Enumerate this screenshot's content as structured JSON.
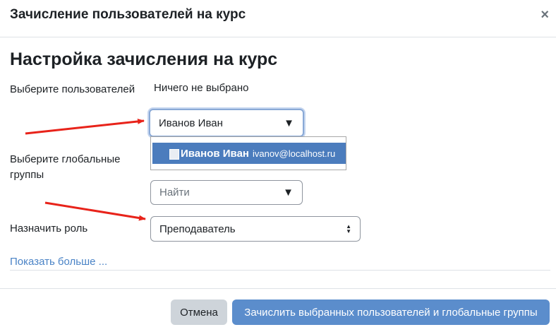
{
  "header": {
    "title": "Зачисление пользователей на курс",
    "close_label": "×"
  },
  "page": {
    "title": "Настройка зачисления на курс"
  },
  "form": {
    "users_label": "Выберите пользователей",
    "users_none_selected": "Ничего не выбрано",
    "users_input_value": "Иванов Иван",
    "caret": "▼",
    "suggestion": {
      "name": "Иванов Иван",
      "email": "ivanov@localhost.ru"
    },
    "groups_label": "Выберите глобальные группы",
    "groups_placeholder": "Найти",
    "role_label": "Назначить роль",
    "role_value": "Преподаватель",
    "show_more": "Показать больше ..."
  },
  "footer": {
    "cancel_label": "Отмена",
    "submit_label": "Зачислить выбранных пользователей и глобальные группы"
  },
  "colors": {
    "primary": "#5b8dcc",
    "selection": "#4b7cbd",
    "link": "#4a83c6",
    "arrow": "#e8231a"
  }
}
